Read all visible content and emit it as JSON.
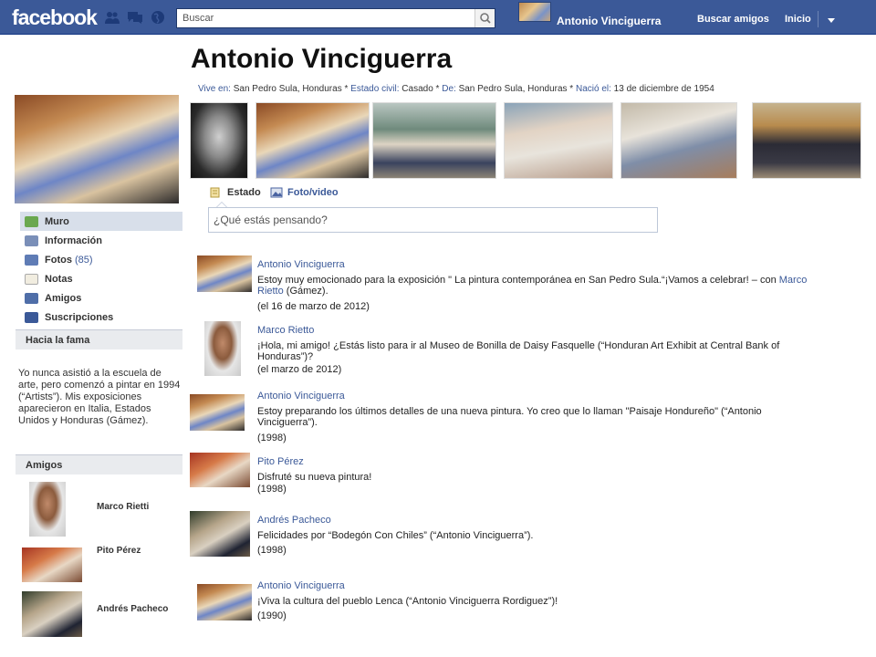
{
  "topbar": {
    "logo": "facebook",
    "search_placeholder": "Buscar",
    "user_name": "Antonio Vinciguerra",
    "find_friends": "Buscar amigos",
    "home": "Inicio",
    "brand_color": "#3b5998"
  },
  "profile": {
    "name": "Antonio Vinciguerra",
    "info": [
      {
        "key": "Vive en:",
        "value": "San Pedro Sula, Honduras *"
      },
      {
        "key": "Estado civil:",
        "value": "Casado *"
      },
      {
        "key": "De:",
        "value": "San Pedro Sula, Honduras *"
      },
      {
        "key": "Nació el:",
        "value": "13  de diciembre de 1954"
      }
    ]
  },
  "sidebar": {
    "items": [
      {
        "label": "Muro",
        "count": "",
        "icon": "wall-icon"
      },
      {
        "label": "Información",
        "count": "",
        "icon": "info-icon"
      },
      {
        "label": "Fotos",
        "count": "(85)",
        "icon": "photos-icon"
      },
      {
        "label": "Notas",
        "count": "",
        "icon": "notes-icon"
      },
      {
        "label": "Amigos",
        "count": "",
        "icon": "friends-icon"
      },
      {
        "label": "Suscripciones",
        "count": "",
        "icon": "rss-icon"
      }
    ],
    "fame_heading": "Hacia la fama",
    "bio": "Yo nunca asistió a la escuela de arte, pero comenzó a pintar en 1994 (“Artists”). Mis exposiciones aparecieron en Italia, Estados Unidos y Honduras (Gámez).",
    "friends_heading": "Amigos",
    "friends": [
      {
        "name": "Marco Rietti"
      },
      {
        "name": "Pito Pérez"
      },
      {
        "name": "Andrés Pacheco"
      }
    ]
  },
  "composer": {
    "tab_status": "Estado",
    "tab_photo": "Foto/video",
    "placeholder": "¿Qué estás pensando?"
  },
  "feed": [
    {
      "author": "Antonio  Vinciguerra",
      "text_before": "Estoy muy emocionado para la exposición \" La pintura contemporánea en San Pedro Sula.“¡Vamos a celebrar! – con ",
      "link": "Marco Rietto",
      "text_after": " (Gámez).",
      "date": "(el 16 de marzo de 2012)"
    },
    {
      "author": "Marco Rietto",
      "text": "¡Hola, mi amigo! ¿Estás listo para ir al Museo de Bonilla de Daisy Fasquelle (“Honduran Art Exhibit at Central Bank of Honduras”)?",
      "date": "(el marzo de 2012)"
    },
    {
      "author": "Antonio  Vinciguerra",
      "text": "Estoy preparando los últimos detalles de una nueva pintura. Yo creo que lo llaman \"Paisaje Hondureño\" (“Antonio Vinciguerra”).",
      "date": "(1998)"
    },
    {
      "author": "Pito Pérez",
      "text": "Disfruté su nueva pintura!",
      "date": "(1998)"
    },
    {
      "author": "Andrés Pacheco",
      "text": "Felicidades por  “Bodegón Con Chiles” (“Antonio Vinciguerra”).",
      "date": "(1998)"
    },
    {
      "author": "Antonio  Vinciguerra",
      "text": "¡Viva la cultura del pueblo Lenca (“Antonio Vinciguerra Rordiguez”)!",
      "date": "(1990)"
    }
  ]
}
